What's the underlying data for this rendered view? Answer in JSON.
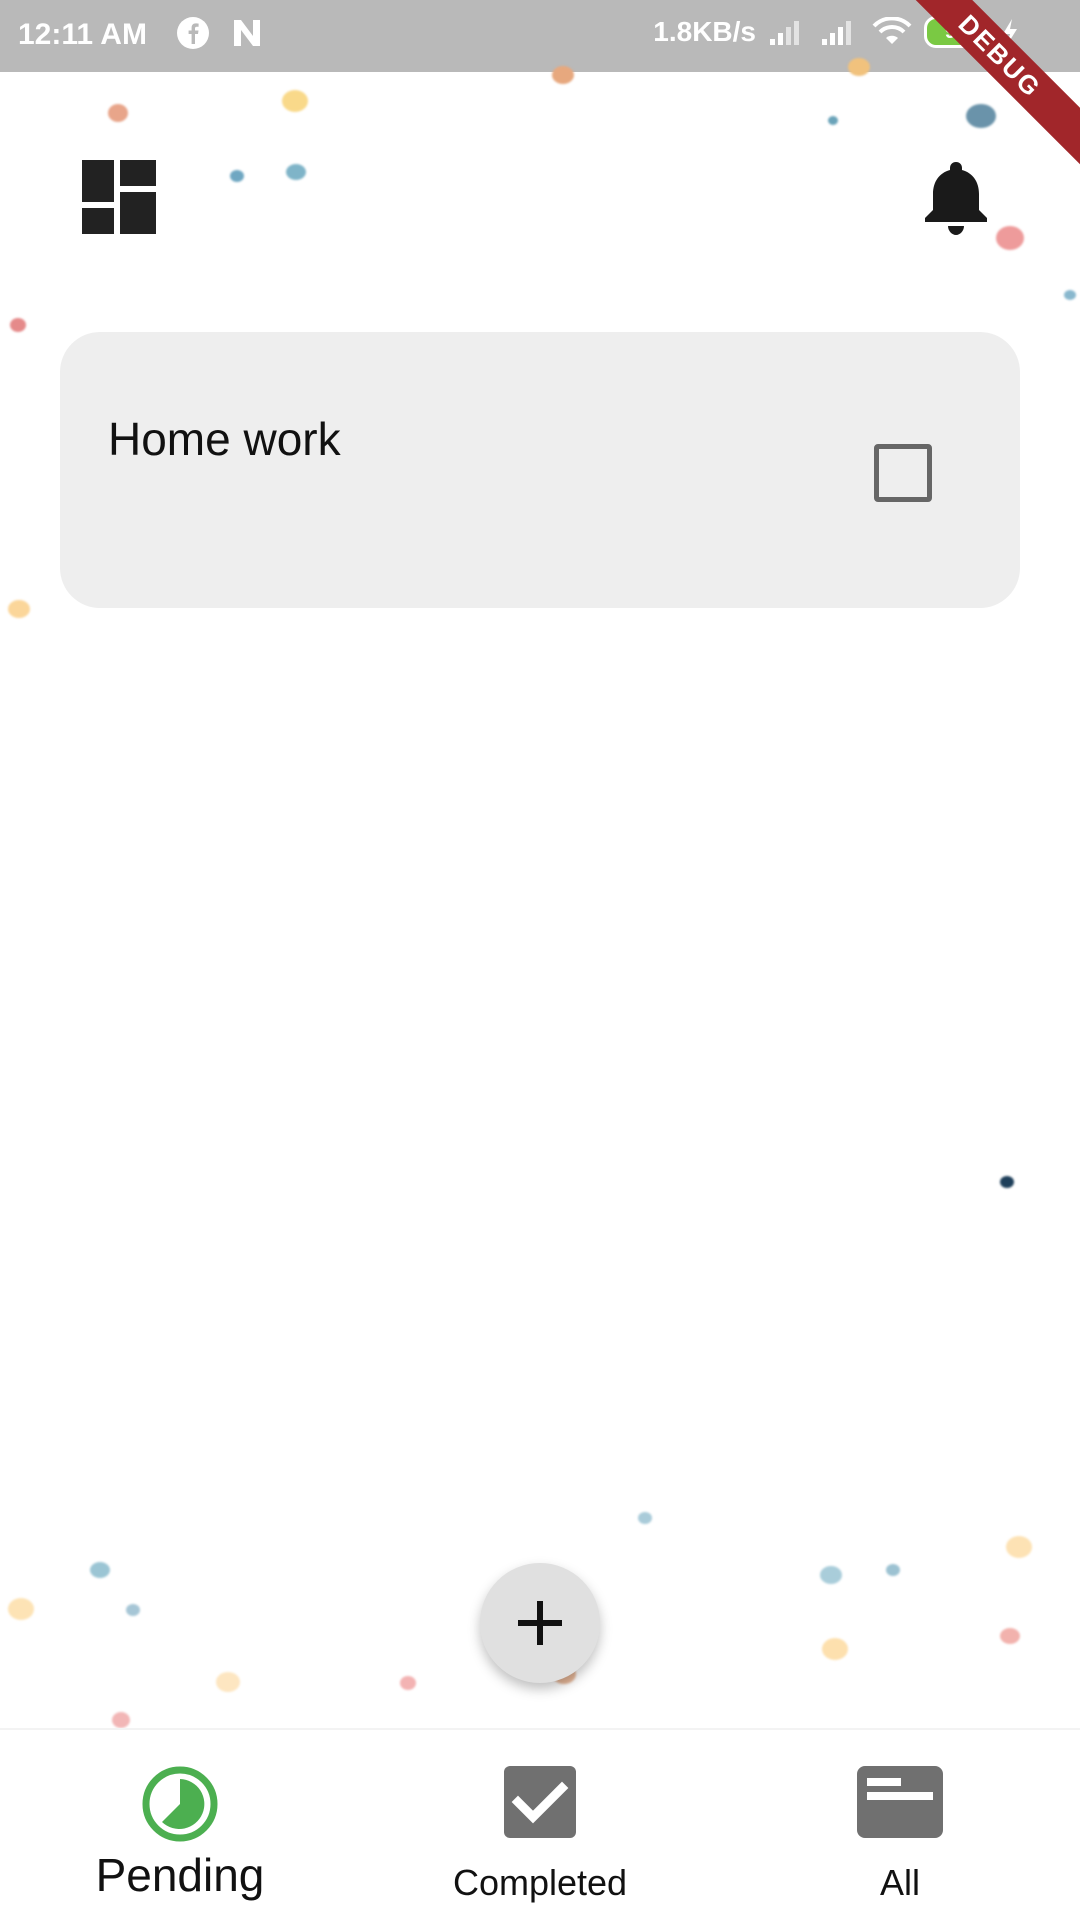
{
  "status_bar": {
    "time": "12:11 AM",
    "net_speed": "1.8KB/s",
    "battery_level": "99",
    "debug_label": "DEBUG"
  },
  "app": {
    "left_icon": "dashboard-icon",
    "right_icon": "bell-icon"
  },
  "tasks": [
    {
      "title": "Home work",
      "completed": false
    }
  ],
  "fab": {
    "icon": "plus-icon"
  },
  "bottom_nav": {
    "items": [
      {
        "label": "Pending",
        "icon": "pending-clock-icon",
        "active": true,
        "color": "#4caf50"
      },
      {
        "label": "Completed",
        "icon": "checkbox-checked-icon",
        "active": false,
        "color": "#707070"
      },
      {
        "label": "All",
        "icon": "list-card-icon",
        "active": false,
        "color": "#707070"
      }
    ]
  },
  "colors": {
    "status_bar_bg": "#b9b9b9",
    "card_bg": "#eeeeee",
    "accent_green": "#4caf50",
    "debug_banner": "#a1262a"
  }
}
